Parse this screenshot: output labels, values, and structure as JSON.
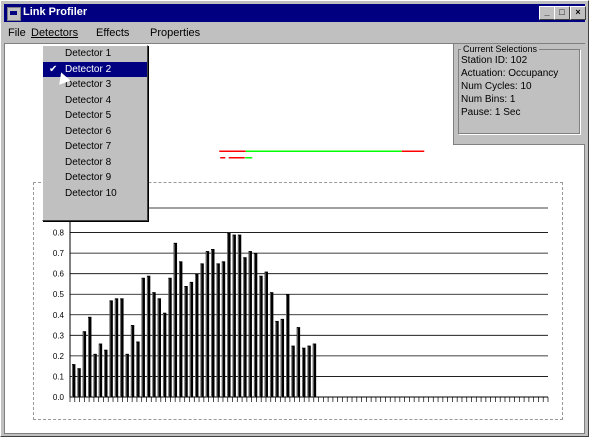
{
  "window": {
    "title": "Link Profiler"
  },
  "titlebar_buttons": [
    "_",
    "□",
    "×"
  ],
  "menu": [
    "File",
    "Detectors",
    "Effects",
    "Properties"
  ],
  "detectors_menu": {
    "items": [
      "Detector 1",
      "Detector 2",
      "Detector 3",
      "Detector 4",
      "Detector 5",
      "Detector 6",
      "Detector 7",
      "Detector 8",
      "Detector 9",
      "Detector 10"
    ],
    "selected_index": 1,
    "check_mark": "✔"
  },
  "current_selections": {
    "title": "Current Selections",
    "station": "Station ID: 102",
    "actuation": "Actuation: Occupancy",
    "num_cycles": "Num Cycles: 10",
    "num_bins": "Num Bins: 1",
    "pause": "Pause: 1 Sec"
  },
  "colors": {
    "red": "#ff0000",
    "green": "#00ff00",
    "bar": "#000000",
    "grid": "#000000"
  },
  "chart_data": {
    "type": "bar",
    "ylim": [
      0,
      0.9
    ],
    "yticks": [
      "0.0",
      "0.1",
      "0.2",
      "0.3",
      "0.4",
      "0.5",
      "0.6",
      "0.7",
      "0.8"
    ],
    "bin_count": 100,
    "values": [
      0.16,
      0.14,
      0.32,
      0.39,
      0.21,
      0.26,
      0.23,
      0.47,
      0.48,
      0.48,
      0.21,
      0.35,
      0.27,
      0.58,
      0.59,
      0.51,
      0.48,
      0.41,
      0.58,
      0.75,
      0.66,
      0.54,
      0.56,
      0.6,
      0.65,
      0.71,
      0.72,
      0.65,
      0.66,
      0.8,
      0.79,
      0.79,
      0.68,
      0.71,
      0.7,
      0.59,
      0.61,
      0.51,
      0.37,
      0.38,
      0.5,
      0.25,
      0.34,
      0.24,
      0.25,
      0.26
    ]
  }
}
